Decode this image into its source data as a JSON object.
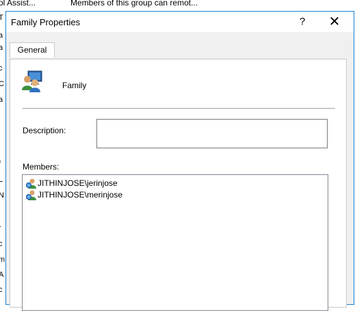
{
  "background": {
    "header_col1": "ol Assist...",
    "header_col2": "Members of this group can remot...",
    "left_strip": [
      "T",
      "a",
      "a",
      "c",
      "C",
      "a",
      "i",
      "f",
      "L",
      "N",
      "r",
      "c",
      "m",
      "A",
      "c"
    ]
  },
  "dialog": {
    "title": "Family Properties",
    "help_label": "?",
    "close_label": "✕",
    "tabs": [
      {
        "label": "General"
      }
    ],
    "group": {
      "icon": "users-group-icon",
      "name": "Family"
    },
    "description": {
      "label": "Description:",
      "value": ""
    },
    "members": {
      "label": "Members:",
      "items": [
        {
          "icon": "user-icon",
          "name": "JITHINJOSE\\jerinjose"
        },
        {
          "icon": "user-icon",
          "name": "JITHINJOSE\\merinjose"
        }
      ]
    }
  }
}
